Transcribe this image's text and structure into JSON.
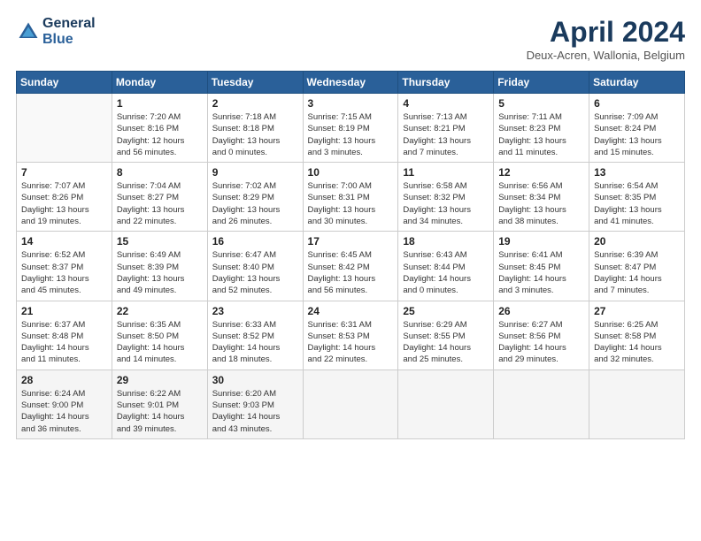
{
  "header": {
    "logo_line1": "General",
    "logo_line2": "Blue",
    "title": "April 2024",
    "location": "Deux-Acren, Wallonia, Belgium"
  },
  "weekdays": [
    "Sunday",
    "Monday",
    "Tuesday",
    "Wednesday",
    "Thursday",
    "Friday",
    "Saturday"
  ],
  "weeks": [
    [
      {
        "day": "",
        "info": ""
      },
      {
        "day": "1",
        "info": "Sunrise: 7:20 AM\nSunset: 8:16 PM\nDaylight: 12 hours\nand 56 minutes."
      },
      {
        "day": "2",
        "info": "Sunrise: 7:18 AM\nSunset: 8:18 PM\nDaylight: 13 hours\nand 0 minutes."
      },
      {
        "day": "3",
        "info": "Sunrise: 7:15 AM\nSunset: 8:19 PM\nDaylight: 13 hours\nand 3 minutes."
      },
      {
        "day": "4",
        "info": "Sunrise: 7:13 AM\nSunset: 8:21 PM\nDaylight: 13 hours\nand 7 minutes."
      },
      {
        "day": "5",
        "info": "Sunrise: 7:11 AM\nSunset: 8:23 PM\nDaylight: 13 hours\nand 11 minutes."
      },
      {
        "day": "6",
        "info": "Sunrise: 7:09 AM\nSunset: 8:24 PM\nDaylight: 13 hours\nand 15 minutes."
      }
    ],
    [
      {
        "day": "7",
        "info": "Sunrise: 7:07 AM\nSunset: 8:26 PM\nDaylight: 13 hours\nand 19 minutes."
      },
      {
        "day": "8",
        "info": "Sunrise: 7:04 AM\nSunset: 8:27 PM\nDaylight: 13 hours\nand 22 minutes."
      },
      {
        "day": "9",
        "info": "Sunrise: 7:02 AM\nSunset: 8:29 PM\nDaylight: 13 hours\nand 26 minutes."
      },
      {
        "day": "10",
        "info": "Sunrise: 7:00 AM\nSunset: 8:31 PM\nDaylight: 13 hours\nand 30 minutes."
      },
      {
        "day": "11",
        "info": "Sunrise: 6:58 AM\nSunset: 8:32 PM\nDaylight: 13 hours\nand 34 minutes."
      },
      {
        "day": "12",
        "info": "Sunrise: 6:56 AM\nSunset: 8:34 PM\nDaylight: 13 hours\nand 38 minutes."
      },
      {
        "day": "13",
        "info": "Sunrise: 6:54 AM\nSunset: 8:35 PM\nDaylight: 13 hours\nand 41 minutes."
      }
    ],
    [
      {
        "day": "14",
        "info": "Sunrise: 6:52 AM\nSunset: 8:37 PM\nDaylight: 13 hours\nand 45 minutes."
      },
      {
        "day": "15",
        "info": "Sunrise: 6:49 AM\nSunset: 8:39 PM\nDaylight: 13 hours\nand 49 minutes."
      },
      {
        "day": "16",
        "info": "Sunrise: 6:47 AM\nSunset: 8:40 PM\nDaylight: 13 hours\nand 52 minutes."
      },
      {
        "day": "17",
        "info": "Sunrise: 6:45 AM\nSunset: 8:42 PM\nDaylight: 13 hours\nand 56 minutes."
      },
      {
        "day": "18",
        "info": "Sunrise: 6:43 AM\nSunset: 8:44 PM\nDaylight: 14 hours\nand 0 minutes."
      },
      {
        "day": "19",
        "info": "Sunrise: 6:41 AM\nSunset: 8:45 PM\nDaylight: 14 hours\nand 3 minutes."
      },
      {
        "day": "20",
        "info": "Sunrise: 6:39 AM\nSunset: 8:47 PM\nDaylight: 14 hours\nand 7 minutes."
      }
    ],
    [
      {
        "day": "21",
        "info": "Sunrise: 6:37 AM\nSunset: 8:48 PM\nDaylight: 14 hours\nand 11 minutes."
      },
      {
        "day": "22",
        "info": "Sunrise: 6:35 AM\nSunset: 8:50 PM\nDaylight: 14 hours\nand 14 minutes."
      },
      {
        "day": "23",
        "info": "Sunrise: 6:33 AM\nSunset: 8:52 PM\nDaylight: 14 hours\nand 18 minutes."
      },
      {
        "day": "24",
        "info": "Sunrise: 6:31 AM\nSunset: 8:53 PM\nDaylight: 14 hours\nand 22 minutes."
      },
      {
        "day": "25",
        "info": "Sunrise: 6:29 AM\nSunset: 8:55 PM\nDaylight: 14 hours\nand 25 minutes."
      },
      {
        "day": "26",
        "info": "Sunrise: 6:27 AM\nSunset: 8:56 PM\nDaylight: 14 hours\nand 29 minutes."
      },
      {
        "day": "27",
        "info": "Sunrise: 6:25 AM\nSunset: 8:58 PM\nDaylight: 14 hours\nand 32 minutes."
      }
    ],
    [
      {
        "day": "28",
        "info": "Sunrise: 6:24 AM\nSunset: 9:00 PM\nDaylight: 14 hours\nand 36 minutes."
      },
      {
        "day": "29",
        "info": "Sunrise: 6:22 AM\nSunset: 9:01 PM\nDaylight: 14 hours\nand 39 minutes."
      },
      {
        "day": "30",
        "info": "Sunrise: 6:20 AM\nSunset: 9:03 PM\nDaylight: 14 hours\nand 43 minutes."
      },
      {
        "day": "",
        "info": ""
      },
      {
        "day": "",
        "info": ""
      },
      {
        "day": "",
        "info": ""
      },
      {
        "day": "",
        "info": ""
      }
    ]
  ]
}
